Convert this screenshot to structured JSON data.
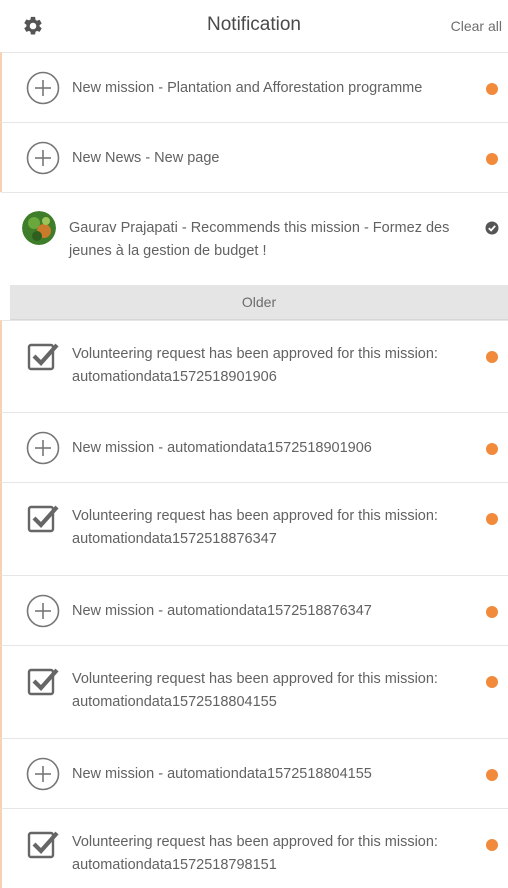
{
  "header": {
    "title": "Notification",
    "clear_all": "Clear all",
    "settings_icon": "gear-icon"
  },
  "recent": [
    {
      "icon": "plus-circle-icon",
      "text": "New mission - Plantation and Afforestation programme",
      "status": "unread"
    },
    {
      "icon": "plus-circle-icon",
      "text": "New News - New page",
      "status": "unread"
    },
    {
      "icon": "avatar",
      "text": "Gaurav Prajapati - Recommends this mission - Formez des jeunes à la gestion de budget !",
      "status": "read"
    }
  ],
  "older_label": "Older",
  "older": [
    {
      "icon": "checkbox-icon",
      "text": "Volunteering request has been approved for this mission: automationdata1572518901906",
      "status": "unread"
    },
    {
      "icon": "plus-circle-icon",
      "text": "New mission - automationdata1572518901906",
      "status": "unread"
    },
    {
      "icon": "checkbox-icon",
      "text": "Volunteering request has been approved for this mission: automationdata1572518876347",
      "status": "unread"
    },
    {
      "icon": "plus-circle-icon",
      "text": "New mission - automationdata1572518876347",
      "status": "unread"
    },
    {
      "icon": "checkbox-icon",
      "text": "Volunteering request has been approved for this mission: automationdata1572518804155",
      "status": "unread"
    },
    {
      "icon": "plus-circle-icon",
      "text": "New mission - automationdata1572518804155",
      "status": "unread"
    },
    {
      "icon": "checkbox-icon",
      "text": "Volunteering request has been approved for this mission: automationdata1572518798151",
      "status": "unread"
    }
  ],
  "colors": {
    "unread_dot": "#f28a3c",
    "read_check": "#555555",
    "section_bg": "#e5e5e5"
  }
}
